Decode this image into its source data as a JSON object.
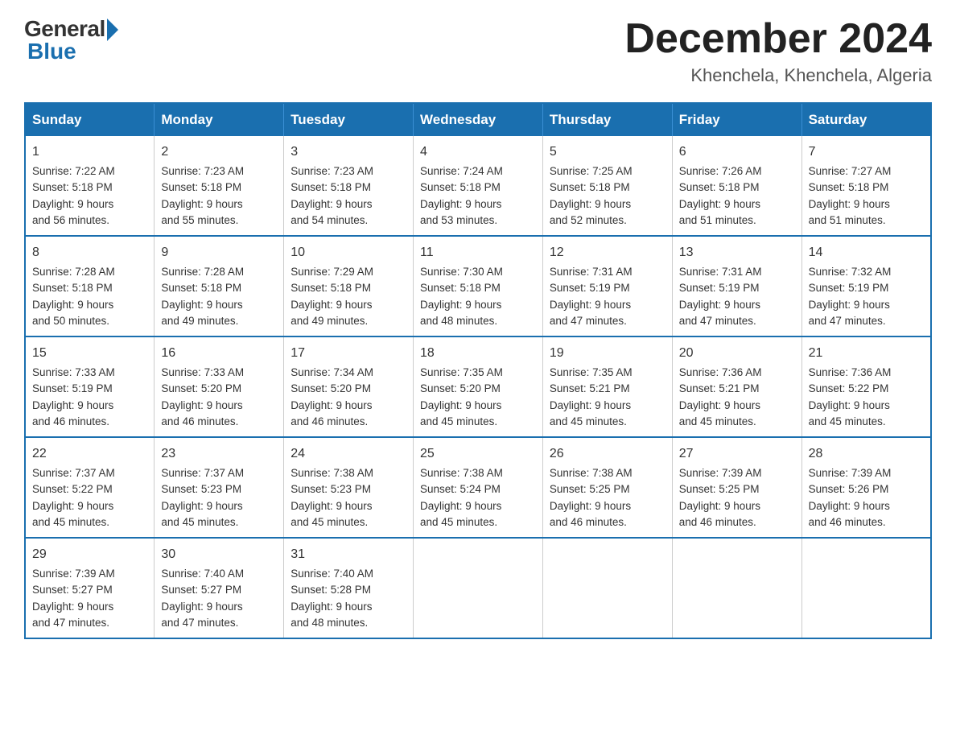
{
  "logo": {
    "general": "General",
    "blue": "Blue"
  },
  "title": "December 2024",
  "location": "Khenchela, Khenchela, Algeria",
  "headers": [
    "Sunday",
    "Monday",
    "Tuesday",
    "Wednesday",
    "Thursday",
    "Friday",
    "Saturday"
  ],
  "weeks": [
    [
      {
        "day": "1",
        "sunrise": "7:22 AM",
        "sunset": "5:18 PM",
        "daylight": "9 hours and 56 minutes."
      },
      {
        "day": "2",
        "sunrise": "7:23 AM",
        "sunset": "5:18 PM",
        "daylight": "9 hours and 55 minutes."
      },
      {
        "day": "3",
        "sunrise": "7:23 AM",
        "sunset": "5:18 PM",
        "daylight": "9 hours and 54 minutes."
      },
      {
        "day": "4",
        "sunrise": "7:24 AM",
        "sunset": "5:18 PM",
        "daylight": "9 hours and 53 minutes."
      },
      {
        "day": "5",
        "sunrise": "7:25 AM",
        "sunset": "5:18 PM",
        "daylight": "9 hours and 52 minutes."
      },
      {
        "day": "6",
        "sunrise": "7:26 AM",
        "sunset": "5:18 PM",
        "daylight": "9 hours and 51 minutes."
      },
      {
        "day": "7",
        "sunrise": "7:27 AM",
        "sunset": "5:18 PM",
        "daylight": "9 hours and 51 minutes."
      }
    ],
    [
      {
        "day": "8",
        "sunrise": "7:28 AM",
        "sunset": "5:18 PM",
        "daylight": "9 hours and 50 minutes."
      },
      {
        "day": "9",
        "sunrise": "7:28 AM",
        "sunset": "5:18 PM",
        "daylight": "9 hours and 49 minutes."
      },
      {
        "day": "10",
        "sunrise": "7:29 AM",
        "sunset": "5:18 PM",
        "daylight": "9 hours and 49 minutes."
      },
      {
        "day": "11",
        "sunrise": "7:30 AM",
        "sunset": "5:18 PM",
        "daylight": "9 hours and 48 minutes."
      },
      {
        "day": "12",
        "sunrise": "7:31 AM",
        "sunset": "5:19 PM",
        "daylight": "9 hours and 47 minutes."
      },
      {
        "day": "13",
        "sunrise": "7:31 AM",
        "sunset": "5:19 PM",
        "daylight": "9 hours and 47 minutes."
      },
      {
        "day": "14",
        "sunrise": "7:32 AM",
        "sunset": "5:19 PM",
        "daylight": "9 hours and 47 minutes."
      }
    ],
    [
      {
        "day": "15",
        "sunrise": "7:33 AM",
        "sunset": "5:19 PM",
        "daylight": "9 hours and 46 minutes."
      },
      {
        "day": "16",
        "sunrise": "7:33 AM",
        "sunset": "5:20 PM",
        "daylight": "9 hours and 46 minutes."
      },
      {
        "day": "17",
        "sunrise": "7:34 AM",
        "sunset": "5:20 PM",
        "daylight": "9 hours and 46 minutes."
      },
      {
        "day": "18",
        "sunrise": "7:35 AM",
        "sunset": "5:20 PM",
        "daylight": "9 hours and 45 minutes."
      },
      {
        "day": "19",
        "sunrise": "7:35 AM",
        "sunset": "5:21 PM",
        "daylight": "9 hours and 45 minutes."
      },
      {
        "day": "20",
        "sunrise": "7:36 AM",
        "sunset": "5:21 PM",
        "daylight": "9 hours and 45 minutes."
      },
      {
        "day": "21",
        "sunrise": "7:36 AM",
        "sunset": "5:22 PM",
        "daylight": "9 hours and 45 minutes."
      }
    ],
    [
      {
        "day": "22",
        "sunrise": "7:37 AM",
        "sunset": "5:22 PM",
        "daylight": "9 hours and 45 minutes."
      },
      {
        "day": "23",
        "sunrise": "7:37 AM",
        "sunset": "5:23 PM",
        "daylight": "9 hours and 45 minutes."
      },
      {
        "day": "24",
        "sunrise": "7:38 AM",
        "sunset": "5:23 PM",
        "daylight": "9 hours and 45 minutes."
      },
      {
        "day": "25",
        "sunrise": "7:38 AM",
        "sunset": "5:24 PM",
        "daylight": "9 hours and 45 minutes."
      },
      {
        "day": "26",
        "sunrise": "7:38 AM",
        "sunset": "5:25 PM",
        "daylight": "9 hours and 46 minutes."
      },
      {
        "day": "27",
        "sunrise": "7:39 AM",
        "sunset": "5:25 PM",
        "daylight": "9 hours and 46 minutes."
      },
      {
        "day": "28",
        "sunrise": "7:39 AM",
        "sunset": "5:26 PM",
        "daylight": "9 hours and 46 minutes."
      }
    ],
    [
      {
        "day": "29",
        "sunrise": "7:39 AM",
        "sunset": "5:27 PM",
        "daylight": "9 hours and 47 minutes."
      },
      {
        "day": "30",
        "sunrise": "7:40 AM",
        "sunset": "5:27 PM",
        "daylight": "9 hours and 47 minutes."
      },
      {
        "day": "31",
        "sunrise": "7:40 AM",
        "sunset": "5:28 PM",
        "daylight": "9 hours and 48 minutes."
      },
      null,
      null,
      null,
      null
    ]
  ],
  "labels": {
    "sunrise": "Sunrise:",
    "sunset": "Sunset:",
    "daylight": "Daylight:"
  }
}
